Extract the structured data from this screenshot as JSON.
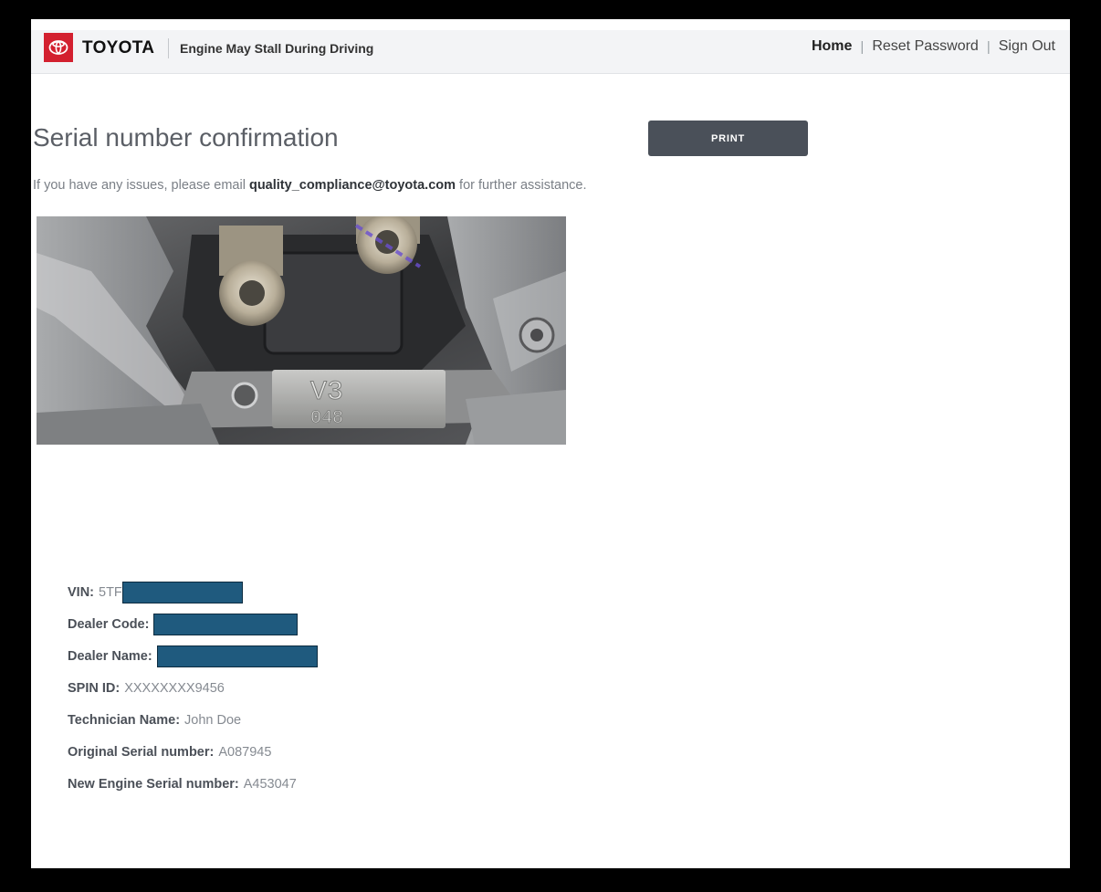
{
  "header": {
    "brand": "TOYOTA",
    "subtitle": "Engine May Stall During Driving",
    "nav": {
      "home": "Home",
      "separator": "|",
      "reset_password": "Reset Password",
      "sign_out": "Sign Out"
    },
    "logo_color": "#d3202f"
  },
  "main": {
    "title": "Serial number confirmation",
    "print_label": "PRINT",
    "help_prefix": "If you have any issues, please email ",
    "help_email": "quality_compliance@toyota.com",
    "help_suffix": " for further assistance.",
    "photo_marking": {
      "line1": "V3",
      "line2": "048"
    }
  },
  "details": {
    "vin_label": "VIN:",
    "vin_value": "5TF",
    "dealer_code_label": "Dealer Code:",
    "dealer_name_label": "Dealer Name:",
    "spin_id_label": "SPIN ID:",
    "spin_id_value": "XXXXXXXX9456",
    "technician_label": "Technician Name:",
    "technician_value": "John Doe",
    "original_serial_label": "Original Serial number:",
    "original_serial_value": "A087945",
    "new_serial_label": "New Engine Serial number:",
    "new_serial_value": "A453047",
    "redaction_color": "#1f5a7e"
  }
}
